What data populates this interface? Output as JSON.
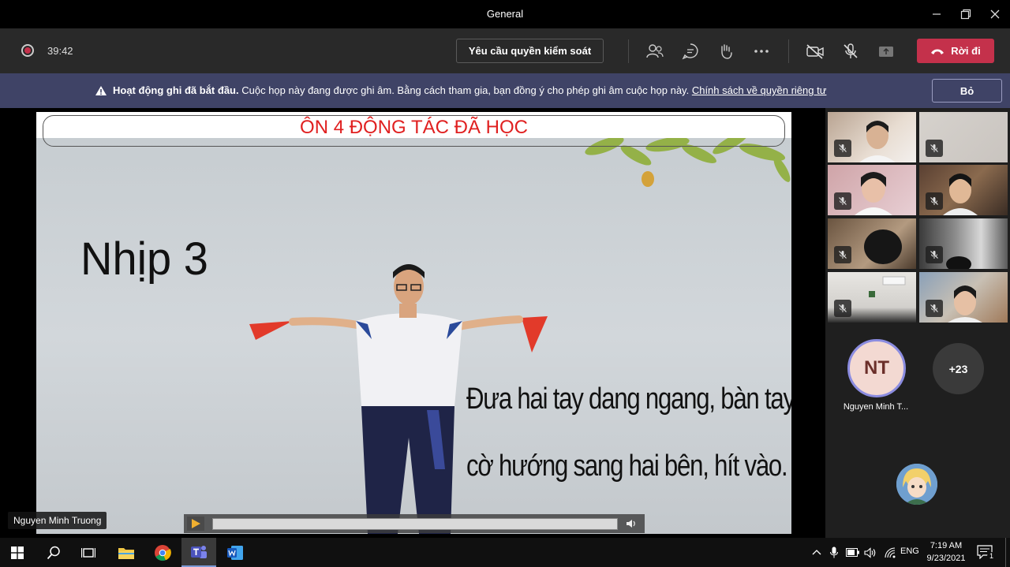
{
  "window": {
    "title": "General"
  },
  "toolbar": {
    "timer": "39:42",
    "request_control_label": "Yêu cầu quyền kiểm soát",
    "leave_label": "Rời đi"
  },
  "banner": {
    "bold_text": "Hoạt động ghi đã bắt đầu.",
    "message": "Cuộc họp này đang được ghi âm. Bằng cách tham gia, bạn đồng ý cho phép ghi âm cuộc họp này.",
    "link_text": "Chính sách về quyền riêng tư",
    "dismiss_label": "Bỏ"
  },
  "slide": {
    "title": "ÔN 4 ĐỘNG TÁC ĐÃ HỌC",
    "step": "Nhịp 3",
    "caption_line1": "Đưa hai tay dang ngang, bàn tay ngửa,",
    "caption_line2": "cờ hướng sang hai bên, hít vào."
  },
  "presenter": {
    "name": "Nguyen Minh Truong"
  },
  "participants": {
    "featured_initials": "NT",
    "featured_name": "Nguyen Minh T...",
    "more_count": "+23"
  },
  "taskbar": {
    "language": "ENG",
    "time": "7:19 AM",
    "date": "9/23/2021",
    "notification_count": "1"
  },
  "colors": {
    "leave_red": "#c4314b",
    "banner_bg": "#3f4366",
    "slide_title_red": "#e02020"
  }
}
